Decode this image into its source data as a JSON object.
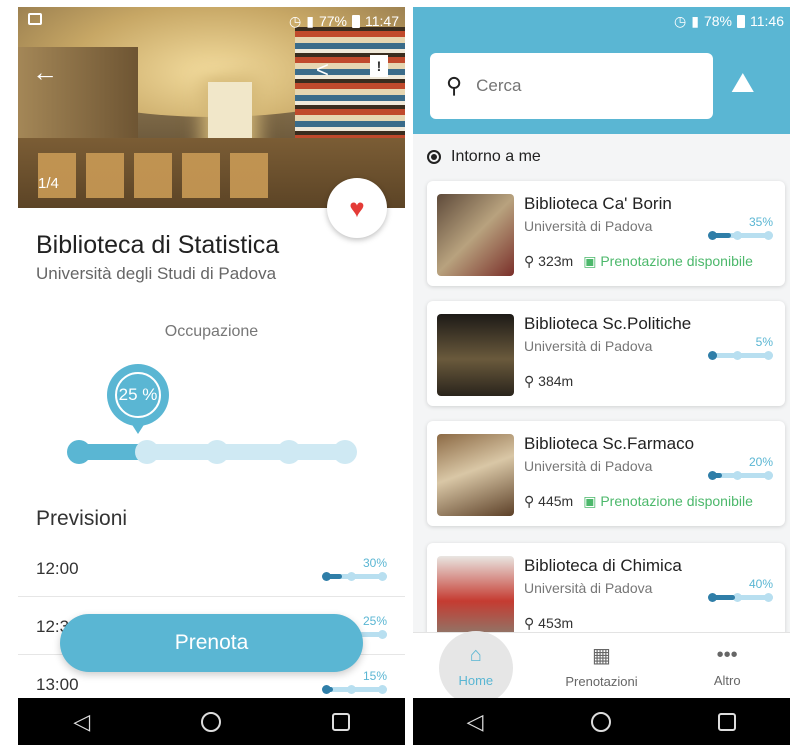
{
  "left": {
    "status": {
      "battery": "77%",
      "time": "11:47"
    },
    "photo_counter": "1/4",
    "title": "Biblioteca di Statistica",
    "subtitle": "Università degli Studi di Padova",
    "occupancy_label": "Occupazione",
    "occupancy_value": "25 %",
    "occupancy_fraction": 0.25,
    "forecast_title": "Previsioni",
    "forecasts": [
      {
        "time": "12:00",
        "pct": "30%",
        "fraction": 0.3
      },
      {
        "time": "12:30",
        "pct": "25%",
        "fraction": 0.25
      },
      {
        "time": "13:00",
        "pct": "15%",
        "fraction": 0.15
      }
    ],
    "book_button": "Prenota"
  },
  "right": {
    "status": {
      "battery": "78%",
      "time": "11:46"
    },
    "search": {
      "placeholder": "Cerca"
    },
    "near_me": "Intorno a me",
    "libraries": [
      {
        "name": "Biblioteca Ca' Borin",
        "university": "Università di Padova",
        "pct": "35%",
        "fraction": 0.35,
        "distance": "323m",
        "availability": "Prenotazione disponibile"
      },
      {
        "name": "Biblioteca Sc.Politiche",
        "university": "Università di Padova",
        "pct": "5%",
        "fraction": 0.05,
        "distance": "384m",
        "availability": ""
      },
      {
        "name": "Biblioteca Sc.Farmaco",
        "university": "Università di Padova",
        "pct": "20%",
        "fraction": 0.2,
        "distance": "445m",
        "availability": "Prenotazione disponibile"
      },
      {
        "name": "Biblioteca di Chimica",
        "university": "Università di Padova",
        "pct": "40%",
        "fraction": 0.4,
        "distance": "453m",
        "availability": ""
      }
    ],
    "tabs": [
      {
        "label": "Home",
        "icon": "home-icon"
      },
      {
        "label": "Prenotazioni",
        "icon": "calendar-icon"
      },
      {
        "label": "Altro",
        "icon": "more-icon"
      }
    ]
  },
  "colors": {
    "accent": "#5ab6d3",
    "accent_dark": "#2f7ea8",
    "available": "#4cb86b",
    "favorite": "#e43b37"
  }
}
